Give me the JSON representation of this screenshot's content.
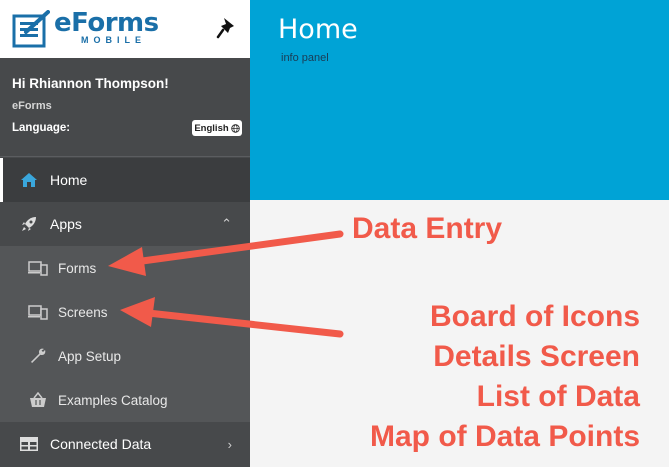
{
  "brand": {
    "title": "eForms",
    "subtitle": "MOBILE"
  },
  "user": {
    "greeting": "Hi Rhiannon Thompson!",
    "org": "eForms",
    "language_label": "Language:",
    "language_value": "English"
  },
  "nav": {
    "home": "Home",
    "apps": "Apps",
    "apps_children": [
      "Forms",
      "Screens",
      "App Setup",
      "Examples Catalog"
    ],
    "connected": "Connected Data"
  },
  "main": {
    "title": "Home",
    "subtitle": "info panel"
  },
  "annotations": {
    "data_entry": "Data Entry",
    "lines": [
      "Board of Icons",
      "Details Screen",
      "List of Data",
      "Map of Data Points"
    ],
    "color": "#f15a4a"
  },
  "colors": {
    "sidebar": "#47494b",
    "banner": "#00a3d6",
    "submenu": "#545658",
    "brand": "#1a6fa8"
  }
}
